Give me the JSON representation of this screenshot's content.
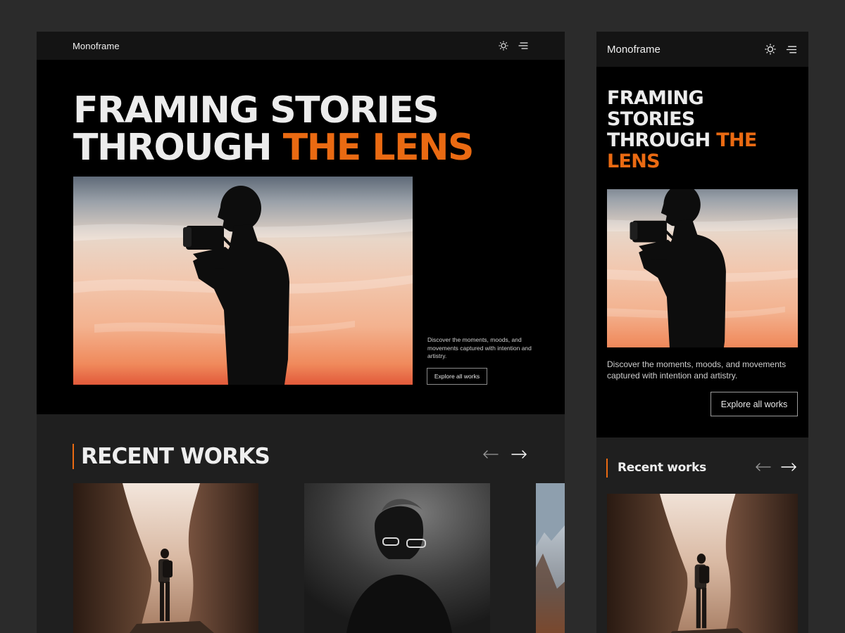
{
  "desktop": {
    "brand": "Monoframe",
    "hero": {
      "title_line1": "FRAMING STORIES",
      "title_line2_plain": "THROUGH ",
      "title_line2_accent": "THE LENS",
      "description": "Discover the moments, moods, and movements captured with intention and artistry.",
      "cta_label": "Explore all works"
    },
    "recent": {
      "title": "RECENT WORKS"
    }
  },
  "mobile": {
    "brand": "Monoframe",
    "hero": {
      "title_line1": "FRAMING",
      "title_line2": "STORIES",
      "title_line3_plain": "THROUGH ",
      "title_line3_accent": "THE",
      "title_line4_accent": "LENS",
      "description": "Discover the moments, moods, and movements captured with intention and artistry.",
      "cta_label": "Explore all works"
    },
    "recent": {
      "title": "Recent works"
    }
  },
  "icons": {
    "theme_toggle": "sun-icon",
    "menu": "menu-icon",
    "prev": "arrow-left-icon",
    "next": "arrow-right-icon"
  },
  "colors": {
    "accent": "#ea6a12",
    "background": "#2b2b2b",
    "hero_bg": "#000000",
    "section_bg": "#1f1f1f"
  }
}
